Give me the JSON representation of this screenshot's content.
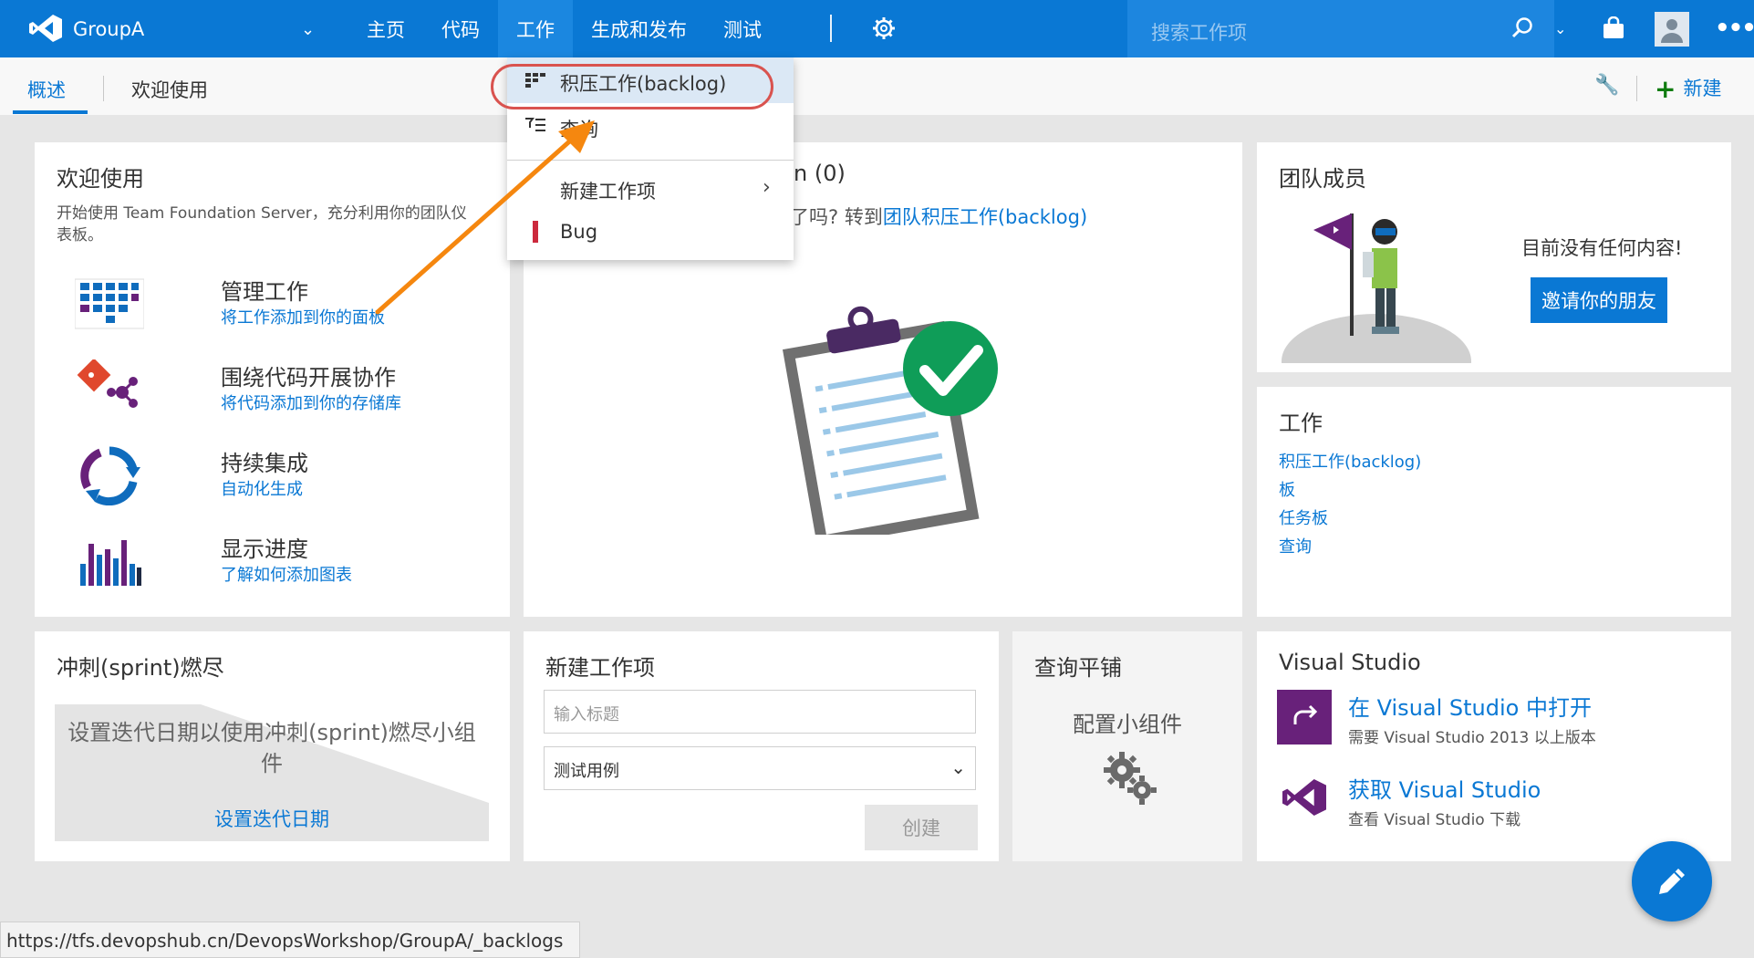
{
  "header": {
    "project_name": "GroupA",
    "tabs": [
      "主页",
      "代码",
      "工作",
      "生成和发布",
      "测试"
    ],
    "active_tab": "工作",
    "search_placeholder": "搜索工作项"
  },
  "subheader": {
    "tabs": [
      "概述",
      "欢迎使用"
    ],
    "new_label": "新建"
  },
  "work_menu": {
    "items": [
      "积压工作(backlog)",
      "查询",
      "新建工作项",
      "Bug"
    ],
    "highlighted": "积压工作(backlog)"
  },
  "welcome": {
    "title": "欢迎使用",
    "desc_line1": "开始使用 Team Foundation Server，充分利用你的团队仪",
    "desc_line2": "表板。",
    "items": [
      {
        "title": "管理工作",
        "link": "将工作添加到你的面板"
      },
      {
        "title": "围绕代码开展协作",
        "link": "将代码添加到你的存储库"
      },
      {
        "title": "持续集成",
        "link": "自动化生成"
      },
      {
        "title": "显示进度",
        "link": "了解如何添加图表"
      }
    ]
  },
  "backlog_card": {
    "title_fragment": "n (0)",
    "text_fragment": "了吗? 转到",
    "link": "团队积压工作(backlog)"
  },
  "team_members": {
    "title": "团队成员",
    "empty_text": "目前没有任何内容!",
    "invite_button": "邀请你的朋友"
  },
  "work_card": {
    "title": "工作",
    "links": [
      "积压工作(backlog)",
      "板",
      "任务板",
      "查询"
    ]
  },
  "sprint": {
    "title": "冲刺(sprint)燃尽",
    "message": "设置迭代日期以使用冲刺(sprint)燃尽小组件",
    "link": "设置迭代日期"
  },
  "new_work_item": {
    "title": "新建工作项",
    "input_placeholder": "输入标题",
    "type_value": "测试用例",
    "create_button": "创建"
  },
  "query_tile": {
    "title": "查询平铺",
    "configure": "配置小组件"
  },
  "visual_studio": {
    "title": "Visual Studio",
    "items": [
      {
        "title": "在 Visual Studio 中打开",
        "sub": "需要 Visual Studio 2013 以上版本"
      },
      {
        "title": "获取 Visual Studio",
        "sub": "查看 Visual Studio 下载"
      }
    ]
  },
  "status_url": "https://tfs.devopshub.cn/DevopsWorkshop/GroupA/_backlogs",
  "colors": {
    "accent": "#0a78d4",
    "annotation_arrow": "#f5870f",
    "highlight_ring": "#d9534f",
    "vs_purple": "#68217a"
  }
}
